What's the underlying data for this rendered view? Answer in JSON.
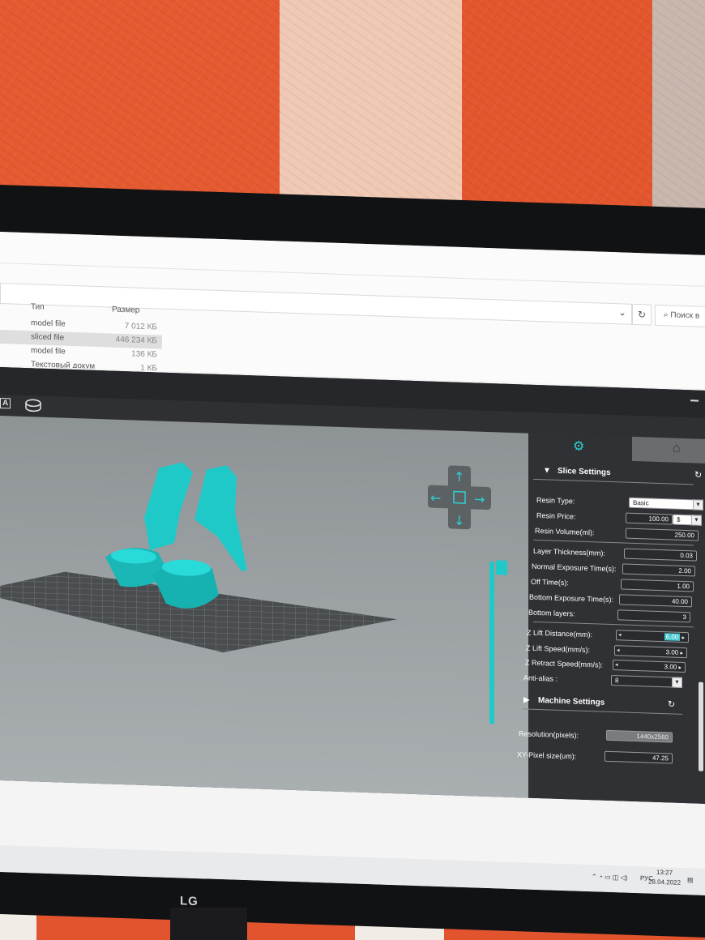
{
  "explorer": {
    "columns": {
      "type": "Тип",
      "size": "Размер"
    },
    "search_placeholder": "Поиск в",
    "files": [
      {
        "type": "model file",
        "size": "7 012 КБ",
        "selected": false
      },
      {
        "type": "sliced file",
        "size": "446 234 КБ",
        "selected": true
      },
      {
        "type": "model file",
        "size": "136 КБ",
        "selected": false
      },
      {
        "type": "Текстовый докум",
        "size": "1 КБ",
        "selected": false
      }
    ]
  },
  "toolbar": {
    "text_tool": "A"
  },
  "slice_settings": {
    "title": "Slice Settings",
    "rows": {
      "resin_type": {
        "label": "Resin Type:",
        "value": "Basic"
      },
      "resin_price": {
        "label": "Resin Price:",
        "value": "100.00",
        "currency": "$"
      },
      "resin_volume": {
        "label": "Resin Volume(ml):",
        "value": "250.00"
      },
      "layer_thickness": {
        "label": "Layer Thickness(mm):",
        "value": "0.03"
      },
      "normal_exposure": {
        "label": "Normal Exposure Time(s):",
        "value": "2.00"
      },
      "off_time": {
        "label": "Off Time(s):",
        "value": "1.00"
      },
      "bottom_exposure": {
        "label": "Bottom Exposure Time(s):",
        "value": "40.00"
      },
      "bottom_layers": {
        "label": "Bottom layers:",
        "value": "3"
      },
      "z_lift_distance": {
        "label": "Z Lift Distance(mm):",
        "value": "6.00"
      },
      "z_lift_speed": {
        "label": "Z Lift Speed(mm/s):",
        "value": "3.00"
      },
      "z_retract_speed": {
        "label": "Z Retract Speed(mm/s):",
        "value": "3.00"
      },
      "anti_alias": {
        "label": "Anti-alias :",
        "value": "8"
      }
    }
  },
  "machine_settings": {
    "title": "Machine Settings",
    "rows": {
      "resolution": {
        "label": "Resolution(pixels):",
        "value": "1440x2560"
      },
      "xy_pixel": {
        "label": "XY-Pixel size(um):",
        "value": "47.25"
      }
    }
  },
  "taskbar": {
    "lang": "РУС",
    "time": "13:27",
    "date": "28.04.2022"
  },
  "monitor": {
    "brand": "LG"
  },
  "colors": {
    "model": "#1fc9c8",
    "accent": "#46c8d0",
    "panel": "#303134"
  }
}
